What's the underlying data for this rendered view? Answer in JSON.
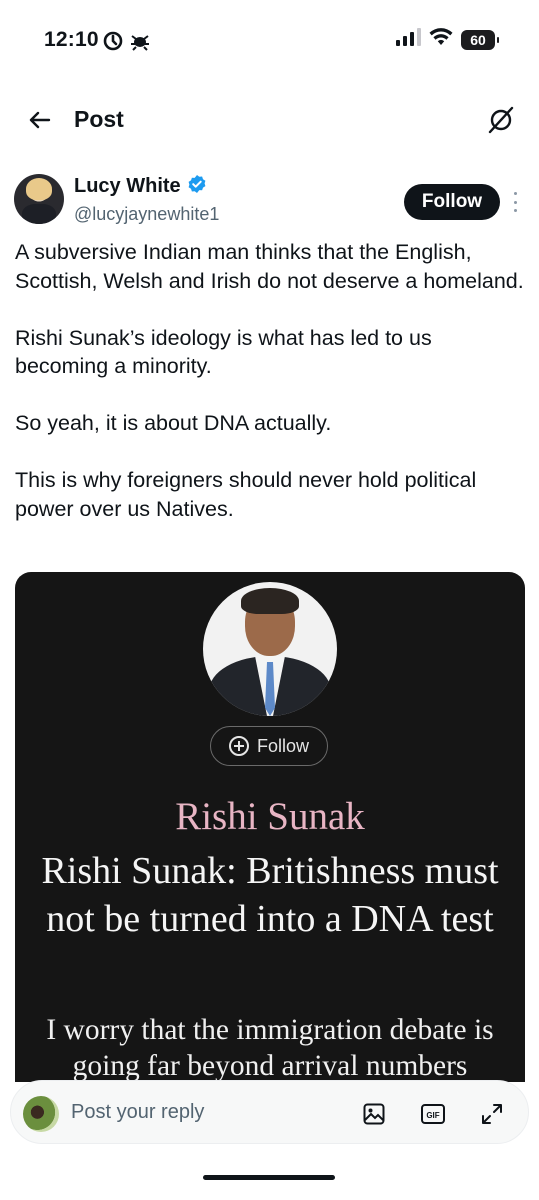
{
  "status_bar": {
    "time": "12:10",
    "battery": "60"
  },
  "header": {
    "title": "Post"
  },
  "author": {
    "name": "Lucy White",
    "handle": "@lucyjaynewhite1",
    "follow_label": "Follow",
    "verified_color": "#1d9bf0"
  },
  "tweet": {
    "paragraphs": [
      "A subversive Indian man thinks that the English, Scottish, Welsh and Irish do not deserve a homeland.",
      "Rishi Sunak’s ideology is what has led to us becoming a minority.",
      "So yeah, it is about DNA actually.",
      "This is why foreigners should never hold political power over us Natives."
    ]
  },
  "media": {
    "follow_label": "Follow",
    "kicker": "Rishi Sunak",
    "headline": "Rishi Sunak: Britishness must not be turned into a DNA test",
    "subheadline": "I worry that the immigration debate is going far beyond arrival numbers"
  },
  "reply": {
    "placeholder": "Post your reply"
  }
}
